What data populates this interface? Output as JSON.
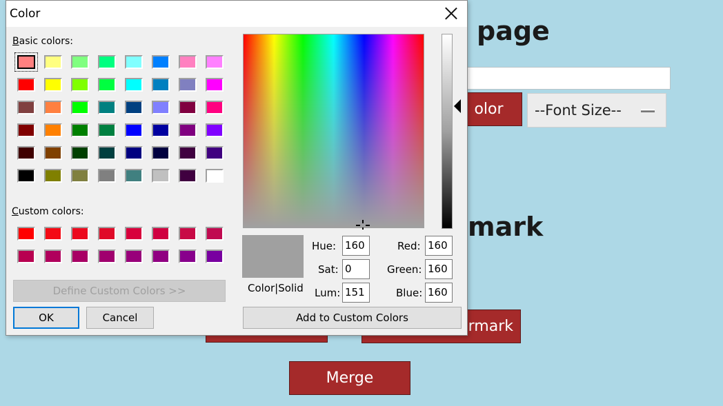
{
  "background_page": {
    "heading_page": "page",
    "heading_watermark": "mark",
    "color_button_label": "olor",
    "font_size_select": "--Font Size--",
    "watermark_button_label": "rmark",
    "merge_button_label": "Merge"
  },
  "dialog": {
    "title": "Color",
    "basic_colors_label": "Basic colors:",
    "custom_colors_label": "Custom colors:",
    "basic_colors": [
      "#ff8080",
      "#ffff80",
      "#80ff80",
      "#00ff80",
      "#80ffff",
      "#0080ff",
      "#ff80c0",
      "#ff80ff",
      "#ff0000",
      "#ffff00",
      "#80ff00",
      "#00ff40",
      "#00ffff",
      "#0080c0",
      "#8080c0",
      "#ff00ff",
      "#804040",
      "#ff8040",
      "#00ff00",
      "#008080",
      "#004080",
      "#8080ff",
      "#800040",
      "#ff0080",
      "#800000",
      "#ff8000",
      "#008000",
      "#008040",
      "#0000ff",
      "#0000a0",
      "#800080",
      "#8000ff",
      "#400000",
      "#804000",
      "#004000",
      "#004040",
      "#000080",
      "#000040",
      "#400040",
      "#400080",
      "#000000",
      "#808000",
      "#808040",
      "#808080",
      "#408080",
      "#c0c0c0",
      "#400040",
      "#ffffff"
    ],
    "custom_colors": [
      "#ff0000",
      "#f40a14",
      "#ec0a1e",
      "#e00a28",
      "#d8003c",
      "#d00040",
      "#c80a46",
      "#c00a50",
      "#b80050",
      "#b0005c",
      "#a80064",
      "#a0006e",
      "#98007a",
      "#900082",
      "#88008c",
      "#7800a0"
    ],
    "define_custom_label": "Define Custom Colors >>",
    "ok_label": "OK",
    "cancel_label": "Cancel",
    "color_solid_label": "Color|Solid",
    "hue_label": "Hue:",
    "sat_label": "Sat:",
    "lum_label": "Lum:",
    "red_label": "Red:",
    "green_label": "Green:",
    "blue_label": "Blue:",
    "hue_value": "160",
    "sat_value": "0",
    "lum_value": "151",
    "red_value": "160",
    "green_value": "160",
    "blue_value": "160",
    "add_custom_label": "Add to Custom Colors",
    "preview_color": "#a0a0a0"
  }
}
